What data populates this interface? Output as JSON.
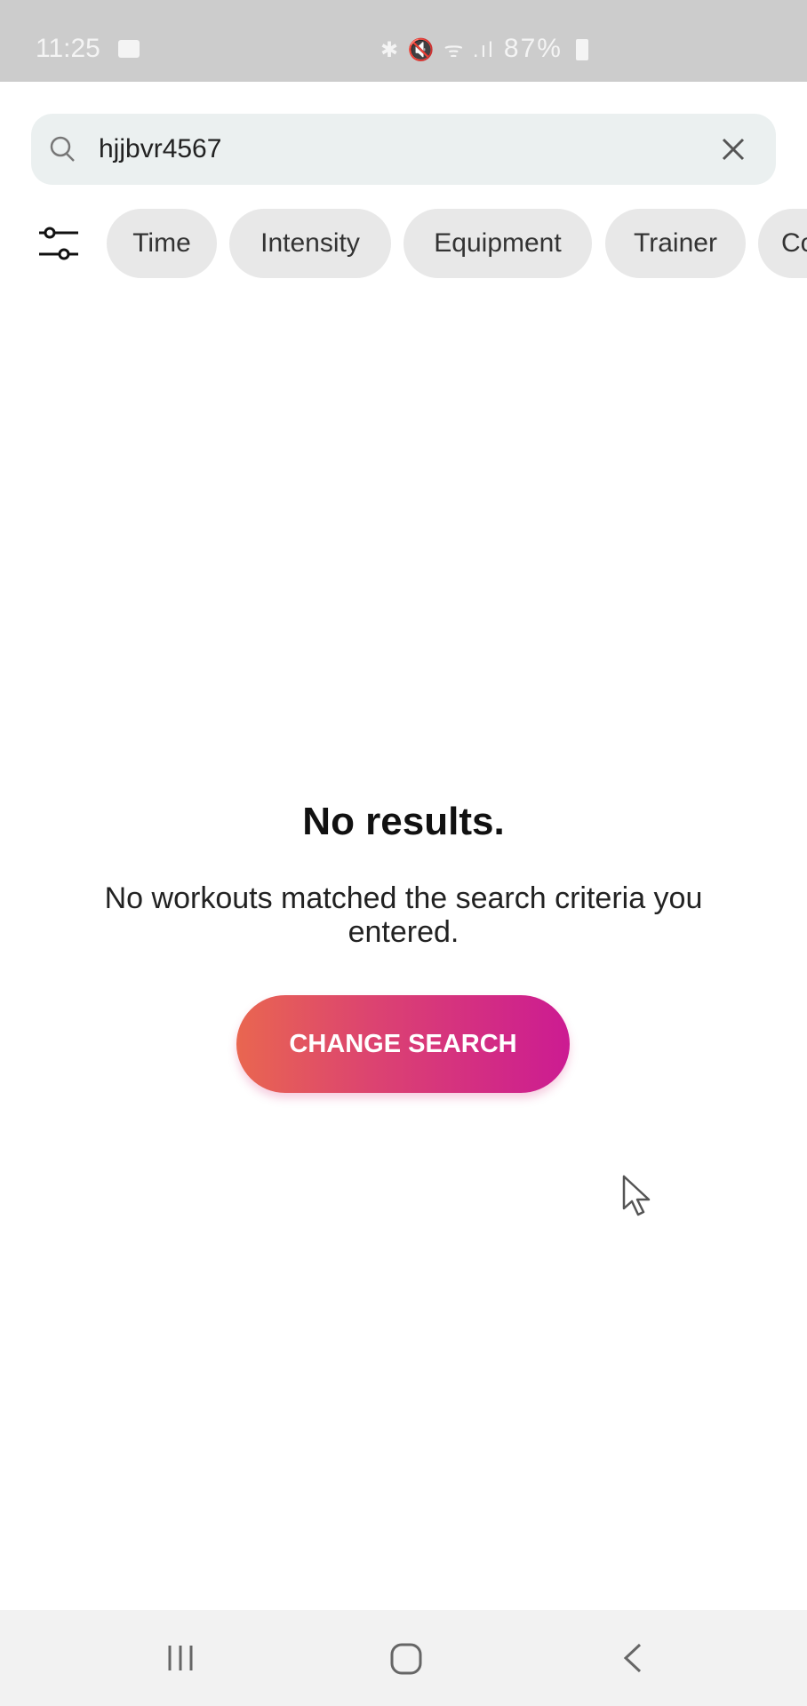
{
  "status_bar": {
    "time": "11:25",
    "icons": "✱ 🔇 ᯤ .ıl",
    "battery": "87%"
  },
  "search": {
    "value": "hjjbvr4567",
    "search_icon": "search-icon",
    "clear_icon": "close-icon"
  },
  "filters": {
    "icon": "sliders-icon",
    "chips": [
      "Time",
      "Intensity",
      "Equipment",
      "Trainer",
      "Co"
    ]
  },
  "empty_state": {
    "title": "No results.",
    "message": "No workouts matched the search criteria you entered.",
    "button_label": "CHANGE SEARCH",
    "gradient": [
      "#e96650",
      "#cc1b92"
    ]
  },
  "nav_bar": {
    "recent": "recent-apps-icon",
    "home": "home-icon",
    "back": "back-icon"
  }
}
